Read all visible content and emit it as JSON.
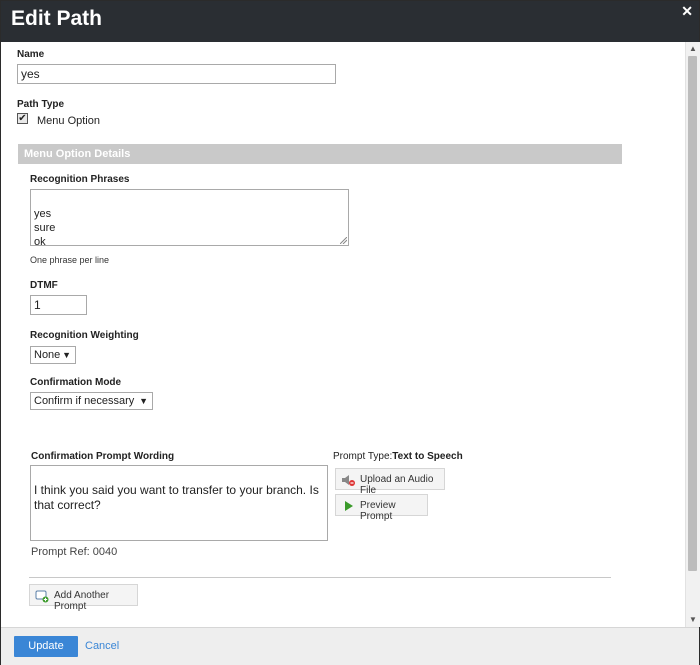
{
  "dialog": {
    "title": "Edit Path",
    "close_glyph": "✕"
  },
  "name": {
    "label": "Name",
    "value": "yes"
  },
  "path_type": {
    "label": "Path Type",
    "checkbox_label": "Menu Option",
    "checked": true
  },
  "section": {
    "title": "Menu Option Details"
  },
  "recognition_phrases": {
    "label": "Recognition Phrases",
    "value": "yes\nsure\nok",
    "hint": "One phrase per line"
  },
  "dtmf": {
    "label": "DTMF",
    "value": "1"
  },
  "weighting": {
    "label": "Recognition Weighting",
    "selected": "None"
  },
  "confirmation_mode": {
    "label": "Confirmation Mode",
    "selected": "Confirm if necessary"
  },
  "prompt": {
    "label": "Confirmation Prompt Wording",
    "value": "I think you said you want to transfer to your branch. Is that correct?",
    "ref": "Prompt Ref: 0040",
    "type_label": "Prompt Type:",
    "type_value": "Text to Speech",
    "upload_label": "Upload an Audio File",
    "preview_label": "Preview Prompt",
    "add_label": "Add Another Prompt"
  },
  "footer": {
    "update_label": "Update",
    "cancel_label": "Cancel"
  },
  "colors": {
    "titlebar": "#2a2e33",
    "accent": "#3a86d6",
    "section": "#c9c9c9"
  },
  "icons": {
    "close": "close-icon",
    "upload": "speaker-icon",
    "preview": "play-icon",
    "add": "add-prompt-icon",
    "dropdown": "chevron-down-icon"
  }
}
